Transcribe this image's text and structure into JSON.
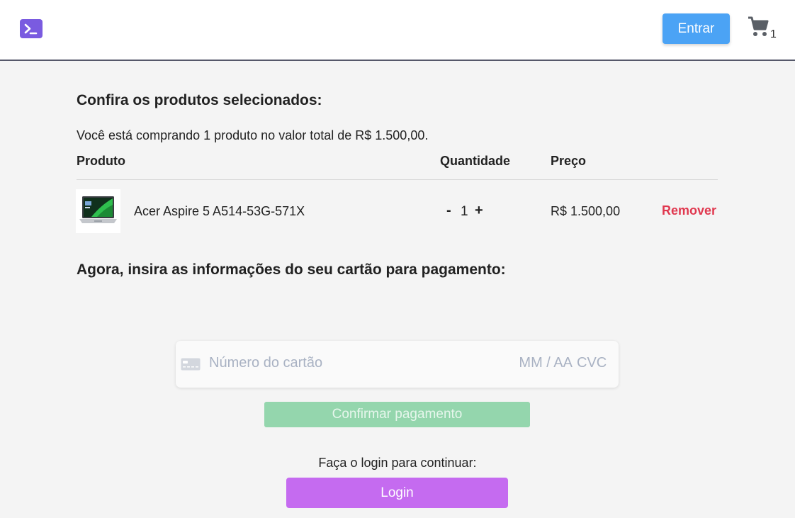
{
  "header": {
    "logo_icon": "terminal-icon",
    "login_button_label": "Entrar",
    "cart_icon": "shopping-cart-icon",
    "cart_count": "1"
  },
  "cart": {
    "title": "Confira os produtos selecionados:",
    "summary": "Você está comprando 1 produto no valor total de R$ 1.500,00.",
    "columns": {
      "product": "Produto",
      "quantity": "Quantidade",
      "price": "Preço"
    },
    "items": [
      {
        "name": "Acer Aspire 5 A514-53G-571X",
        "quantity": "1",
        "decrement_label": "-",
        "increment_label": "+",
        "price": "R$ 1.500,00",
        "remove_label": "Remover"
      }
    ]
  },
  "payment": {
    "title": "Agora, insira as informações do seu cartão para pagamento:",
    "card_icon": "credit-card-icon",
    "card_number_placeholder": "Número do cartão",
    "expiry_placeholder": "MM / AA",
    "cvc_placeholder": "CVC",
    "confirm_label": "Confirmar pagamento",
    "login_prompt": "Faça o login para continuar:",
    "login_label": "Login"
  },
  "colors": {
    "brand": "#7a5be0",
    "entrar_button": "#4ba3f5",
    "remove_text": "#e0384f",
    "confirm_button_disabled": "#94d6ad",
    "login_button": "#c56bf0",
    "background": "#f4f4f4"
  }
}
